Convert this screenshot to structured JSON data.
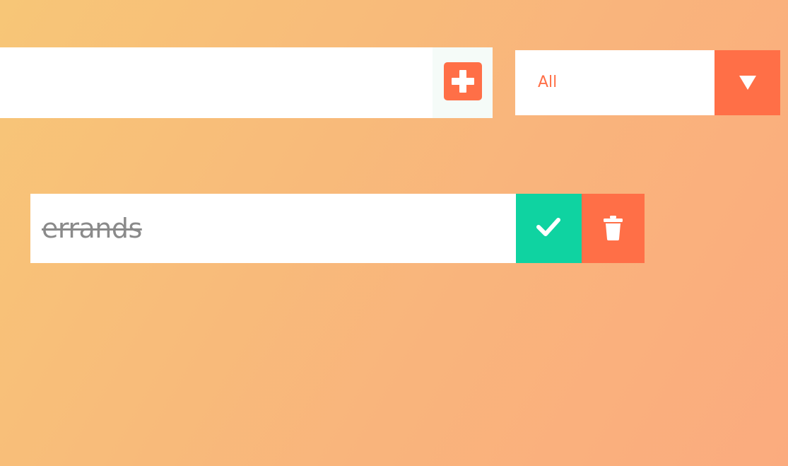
{
  "new_todo": {
    "value": "",
    "placeholder": "",
    "add_icon": "plus-square-icon"
  },
  "filter": {
    "selected": "All",
    "arrow_icon": "triangle-down-icon"
  },
  "todos": [
    {
      "text": "errands",
      "completed": true,
      "complete_icon": "check-icon",
      "delete_icon": "trash-icon"
    }
  ],
  "colors": {
    "accent": "#ff6f47",
    "complete": "#0fd3a1",
    "background_start": "#f7c677",
    "background_end": "#fbab7e",
    "completed_text": "#8a8a8a"
  }
}
